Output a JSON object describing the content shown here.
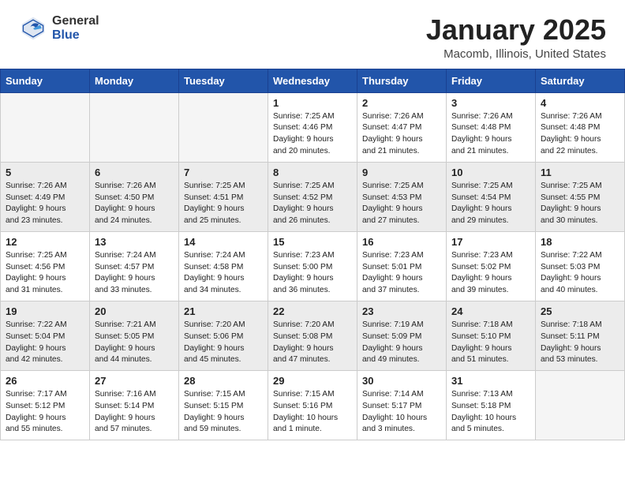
{
  "header": {
    "logo_general": "General",
    "logo_blue": "Blue",
    "title": "January 2025",
    "location": "Macomb, Illinois, United States"
  },
  "days_of_week": [
    "Sunday",
    "Monday",
    "Tuesday",
    "Wednesday",
    "Thursday",
    "Friday",
    "Saturday"
  ],
  "weeks": [
    [
      {
        "num": "",
        "info": ""
      },
      {
        "num": "",
        "info": ""
      },
      {
        "num": "",
        "info": ""
      },
      {
        "num": "1",
        "info": "Sunrise: 7:25 AM\nSunset: 4:46 PM\nDaylight: 9 hours\nand 20 minutes."
      },
      {
        "num": "2",
        "info": "Sunrise: 7:26 AM\nSunset: 4:47 PM\nDaylight: 9 hours\nand 21 minutes."
      },
      {
        "num": "3",
        "info": "Sunrise: 7:26 AM\nSunset: 4:48 PM\nDaylight: 9 hours\nand 21 minutes."
      },
      {
        "num": "4",
        "info": "Sunrise: 7:26 AM\nSunset: 4:48 PM\nDaylight: 9 hours\nand 22 minutes."
      }
    ],
    [
      {
        "num": "5",
        "info": "Sunrise: 7:26 AM\nSunset: 4:49 PM\nDaylight: 9 hours\nand 23 minutes."
      },
      {
        "num": "6",
        "info": "Sunrise: 7:26 AM\nSunset: 4:50 PM\nDaylight: 9 hours\nand 24 minutes."
      },
      {
        "num": "7",
        "info": "Sunrise: 7:25 AM\nSunset: 4:51 PM\nDaylight: 9 hours\nand 25 minutes."
      },
      {
        "num": "8",
        "info": "Sunrise: 7:25 AM\nSunset: 4:52 PM\nDaylight: 9 hours\nand 26 minutes."
      },
      {
        "num": "9",
        "info": "Sunrise: 7:25 AM\nSunset: 4:53 PM\nDaylight: 9 hours\nand 27 minutes."
      },
      {
        "num": "10",
        "info": "Sunrise: 7:25 AM\nSunset: 4:54 PM\nDaylight: 9 hours\nand 29 minutes."
      },
      {
        "num": "11",
        "info": "Sunrise: 7:25 AM\nSunset: 4:55 PM\nDaylight: 9 hours\nand 30 minutes."
      }
    ],
    [
      {
        "num": "12",
        "info": "Sunrise: 7:25 AM\nSunset: 4:56 PM\nDaylight: 9 hours\nand 31 minutes."
      },
      {
        "num": "13",
        "info": "Sunrise: 7:24 AM\nSunset: 4:57 PM\nDaylight: 9 hours\nand 33 minutes."
      },
      {
        "num": "14",
        "info": "Sunrise: 7:24 AM\nSunset: 4:58 PM\nDaylight: 9 hours\nand 34 minutes."
      },
      {
        "num": "15",
        "info": "Sunrise: 7:23 AM\nSunset: 5:00 PM\nDaylight: 9 hours\nand 36 minutes."
      },
      {
        "num": "16",
        "info": "Sunrise: 7:23 AM\nSunset: 5:01 PM\nDaylight: 9 hours\nand 37 minutes."
      },
      {
        "num": "17",
        "info": "Sunrise: 7:23 AM\nSunset: 5:02 PM\nDaylight: 9 hours\nand 39 minutes."
      },
      {
        "num": "18",
        "info": "Sunrise: 7:22 AM\nSunset: 5:03 PM\nDaylight: 9 hours\nand 40 minutes."
      }
    ],
    [
      {
        "num": "19",
        "info": "Sunrise: 7:22 AM\nSunset: 5:04 PM\nDaylight: 9 hours\nand 42 minutes."
      },
      {
        "num": "20",
        "info": "Sunrise: 7:21 AM\nSunset: 5:05 PM\nDaylight: 9 hours\nand 44 minutes."
      },
      {
        "num": "21",
        "info": "Sunrise: 7:20 AM\nSunset: 5:06 PM\nDaylight: 9 hours\nand 45 minutes."
      },
      {
        "num": "22",
        "info": "Sunrise: 7:20 AM\nSunset: 5:08 PM\nDaylight: 9 hours\nand 47 minutes."
      },
      {
        "num": "23",
        "info": "Sunrise: 7:19 AM\nSunset: 5:09 PM\nDaylight: 9 hours\nand 49 minutes."
      },
      {
        "num": "24",
        "info": "Sunrise: 7:18 AM\nSunset: 5:10 PM\nDaylight: 9 hours\nand 51 minutes."
      },
      {
        "num": "25",
        "info": "Sunrise: 7:18 AM\nSunset: 5:11 PM\nDaylight: 9 hours\nand 53 minutes."
      }
    ],
    [
      {
        "num": "26",
        "info": "Sunrise: 7:17 AM\nSunset: 5:12 PM\nDaylight: 9 hours\nand 55 minutes."
      },
      {
        "num": "27",
        "info": "Sunrise: 7:16 AM\nSunset: 5:14 PM\nDaylight: 9 hours\nand 57 minutes."
      },
      {
        "num": "28",
        "info": "Sunrise: 7:15 AM\nSunset: 5:15 PM\nDaylight: 9 hours\nand 59 minutes."
      },
      {
        "num": "29",
        "info": "Sunrise: 7:15 AM\nSunset: 5:16 PM\nDaylight: 10 hours\nand 1 minute."
      },
      {
        "num": "30",
        "info": "Sunrise: 7:14 AM\nSunset: 5:17 PM\nDaylight: 10 hours\nand 3 minutes."
      },
      {
        "num": "31",
        "info": "Sunrise: 7:13 AM\nSunset: 5:18 PM\nDaylight: 10 hours\nand 5 minutes."
      },
      {
        "num": "",
        "info": ""
      }
    ]
  ]
}
